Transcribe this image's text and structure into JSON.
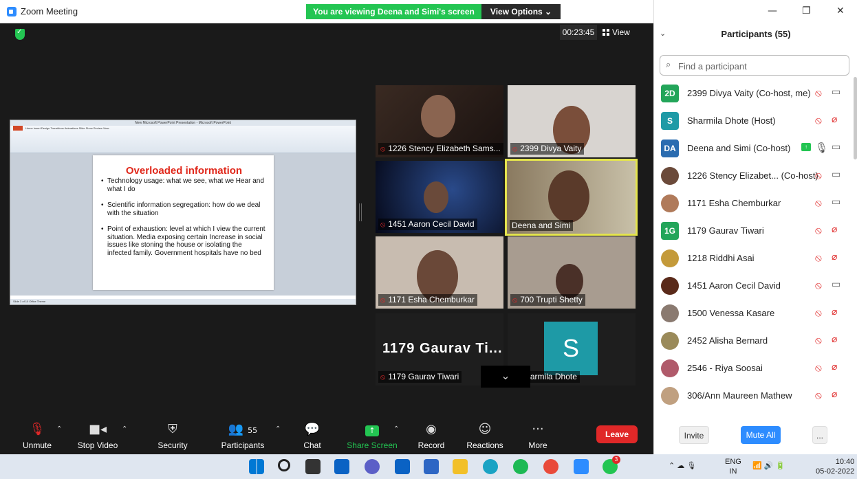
{
  "window": {
    "title": "Zoom Meeting",
    "viewing_banner": "You are viewing Deena and Simi's screen",
    "view_options": "View Options ⌄",
    "minimize": "—",
    "maximize": "❐",
    "close": "✕"
  },
  "meeting": {
    "timer": "00:23:45",
    "view_label": "View"
  },
  "shared_screen": {
    "window_title": "New Microsoft PowerPoint Presentation - Microsoft PowerPoint",
    "ribbon_tabs": "Home   Insert   Design   Transitions   Animations   Slide Show   Review   View",
    "status": "Slide 3 of 10   Office Theme",
    "slide_title": "Overloaded information",
    "bullets": [
      "Technology usage: what we see, what we Hear and what I do",
      "Scientific information segregation: how do we deal with the situation",
      "Point of exhaustion: level at which I view the current situation. Media exposing certain Increase in social issues like stoning the house or isolating the infected family. Government hospitals have no bed"
    ]
  },
  "tiles": [
    {
      "name": "1226 Stency Elizabeth Sams...",
      "muted": true
    },
    {
      "name": "2399 Divya Vaity",
      "muted": true
    },
    {
      "name": "1451 Aaron Cecil David",
      "muted": true
    },
    {
      "name": "Deena and Simi",
      "muted": false
    },
    {
      "name": "1171 Esha Chemburkar",
      "muted": true
    },
    {
      "name": "700 Trupti Shetty",
      "muted": true
    },
    {
      "name": "1179 Gaurav Tiwari",
      "muted": true,
      "display": "1179 Gaurav Ti..."
    },
    {
      "name": "Sharmila Dhote",
      "muted": true,
      "avatar_letter": "S"
    }
  ],
  "toolbar": {
    "unmute": "Unmute",
    "stop_video": "Stop Video",
    "security": "Security",
    "participants": "Participants",
    "participants_count": "55",
    "chat": "Chat",
    "share_screen": "Share Screen",
    "record": "Record",
    "reactions": "Reactions",
    "more": "More",
    "leave": "Leave"
  },
  "participants_panel": {
    "title": "Participants (55)",
    "search_placeholder": "Find a participant",
    "invite": "Invite",
    "mute_all": "Mute All",
    "more": "...",
    "items": [
      {
        "initials": "2D",
        "color": "#23a55a",
        "name": "2399 Divya Vaity (Co-host, me)",
        "mic": "muted",
        "cam": "on"
      },
      {
        "initials": "S",
        "color": "#1e9aa6",
        "name": "Sharmila Dhote (Host)",
        "mic": "muted",
        "cam": "off"
      },
      {
        "initials": "DA",
        "color": "#2b6cb0",
        "name": "Deena and Simi (Co-host)",
        "mic": "on",
        "cam": "on",
        "sharing": true
      },
      {
        "initials": "",
        "color": "#6b4a3a",
        "name": "1226 Stency Elizabet...  (Co-host)",
        "mic": "muted",
        "cam": "on"
      },
      {
        "initials": "",
        "color": "#b07a5a",
        "name": "1171 Esha Chemburkar",
        "mic": "muted",
        "cam": "on"
      },
      {
        "initials": "1G",
        "color": "#23a55a",
        "name": "1179 Gaurav Tiwari",
        "mic": "muted",
        "cam": "off"
      },
      {
        "initials": "",
        "color": "#c49a3a",
        "name": "1218 Riddhi Asai",
        "mic": "muted",
        "cam": "off"
      },
      {
        "initials": "",
        "color": "#5a2a1a",
        "name": "1451 Aaron Cecil David",
        "mic": "muted",
        "cam": "on"
      },
      {
        "initials": "",
        "color": "#8a7a70",
        "name": "1500 Venessa Kasare",
        "mic": "muted",
        "cam": "off"
      },
      {
        "initials": "",
        "color": "#9a8a5a",
        "name": "2452 Alisha Bernard",
        "mic": "muted",
        "cam": "off"
      },
      {
        "initials": "",
        "color": "#b05a6a",
        "name": "2546 - Riya Soosai",
        "mic": "muted",
        "cam": "off"
      },
      {
        "initials": "",
        "color": "#c0a080",
        "name": "306/Ann Maureen Mathew",
        "mic": "muted",
        "cam": "off"
      }
    ]
  },
  "taskbar": {
    "lang_top": "ENG",
    "lang_bottom": "IN",
    "time": "10:40",
    "date": "05-02-2022",
    "whatsapp_badge": "3"
  }
}
